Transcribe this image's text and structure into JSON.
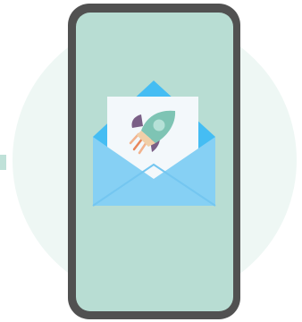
{
  "colors": {
    "background_circle": "#eef7f4",
    "phone_frame": "#515151",
    "screen": "#b8ddd3",
    "envelope_back": "#45bdf3",
    "envelope_front": "#86d0f4",
    "letter": "#f3f8fb",
    "rocket_body": "#7ec4b4",
    "rocket_window": "#b5e1d7",
    "rocket_fins": "#7a5f86",
    "rocket_flame": "#e8865a"
  },
  "illustration": {
    "icon": "email-rocket-icon"
  }
}
